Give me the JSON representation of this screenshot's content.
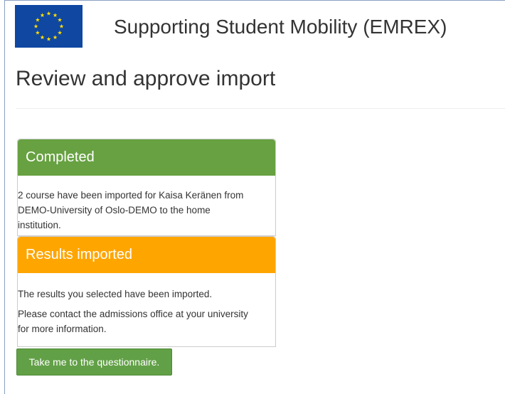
{
  "header": {
    "logo_icon": "eu-flag-icon",
    "site_title": "Supporting Student Mobility (EMREX)"
  },
  "page": {
    "title": "Review and approve import"
  },
  "colors": {
    "flag_blue": "#0f47a1",
    "flag_star": "#ffdd00",
    "completed_green": "#67a141",
    "imported_orange": "#ffa500",
    "button_green": "#62a047"
  },
  "panels": {
    "completed": {
      "heading": "Completed",
      "line1": "2 course have been imported for Kaisa Keränen from",
      "line2": "DEMO-University of Oslo-DEMO to the home",
      "line3": "institution."
    },
    "imported": {
      "heading": "Results imported",
      "message": "The results you selected have been imported.",
      "contact_line1": "Please contact the admissions office at your university",
      "contact_line2": "for more information."
    }
  },
  "actions": {
    "questionnaire_label": "Take me to the questionnaire."
  }
}
